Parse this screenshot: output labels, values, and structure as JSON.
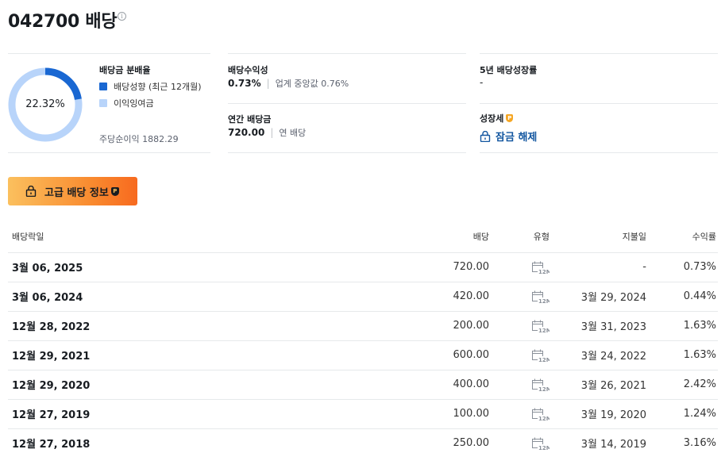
{
  "page_title": "042700 배당",
  "payout": {
    "title": "배당금 분배율",
    "percent": 22.32,
    "percent_label": "22.32%",
    "legend": [
      {
        "label": "배당성향 (최근 12개월)",
        "color": "#1967d2"
      },
      {
        "label": "이익잉여금",
        "color": "#b8d4fa"
      }
    ],
    "eps_text": "주당순이익 1882.29"
  },
  "yield": {
    "title": "배당수익성",
    "value": "0.73%",
    "sub": "업계 중앙값 0.76%"
  },
  "annual": {
    "title": "연간 배당금",
    "value": "720.00",
    "sub": "연 배당"
  },
  "growth5y": {
    "title": "5년 배당성장률",
    "value": "-"
  },
  "growth_streak": {
    "title": "성장세",
    "unlock_label": "잠금 해제"
  },
  "advanced_button": {
    "label": "고급 배당 정보"
  },
  "table": {
    "headers": {
      "ex_date": "배당락일",
      "dividend": "배당",
      "type": "유형",
      "pay_date": "지불일",
      "yield": "수익률"
    },
    "type_icon_label": "12M",
    "rows": [
      {
        "ex_date": "3월 06, 2025",
        "dividend": "720.00",
        "pay_date": "-",
        "yield": "0.73%"
      },
      {
        "ex_date": "3월 06, 2024",
        "dividend": "420.00",
        "pay_date": "3월 29, 2024",
        "yield": "0.44%"
      },
      {
        "ex_date": "12월 28, 2022",
        "dividend": "200.00",
        "pay_date": "3월 31, 2023",
        "yield": "1.63%"
      },
      {
        "ex_date": "12월 29, 2021",
        "dividend": "600.00",
        "pay_date": "3월 24, 2022",
        "yield": "1.63%"
      },
      {
        "ex_date": "12월 29, 2020",
        "dividend": "400.00",
        "pay_date": "3월 26, 2021",
        "yield": "2.42%"
      },
      {
        "ex_date": "12월 27, 2019",
        "dividend": "100.00",
        "pay_date": "3월 19, 2020",
        "yield": "1.24%"
      },
      {
        "ex_date": "12월 27, 2018",
        "dividend": "250.00",
        "pay_date": "3월 14, 2019",
        "yield": "3.16%"
      }
    ]
  }
}
